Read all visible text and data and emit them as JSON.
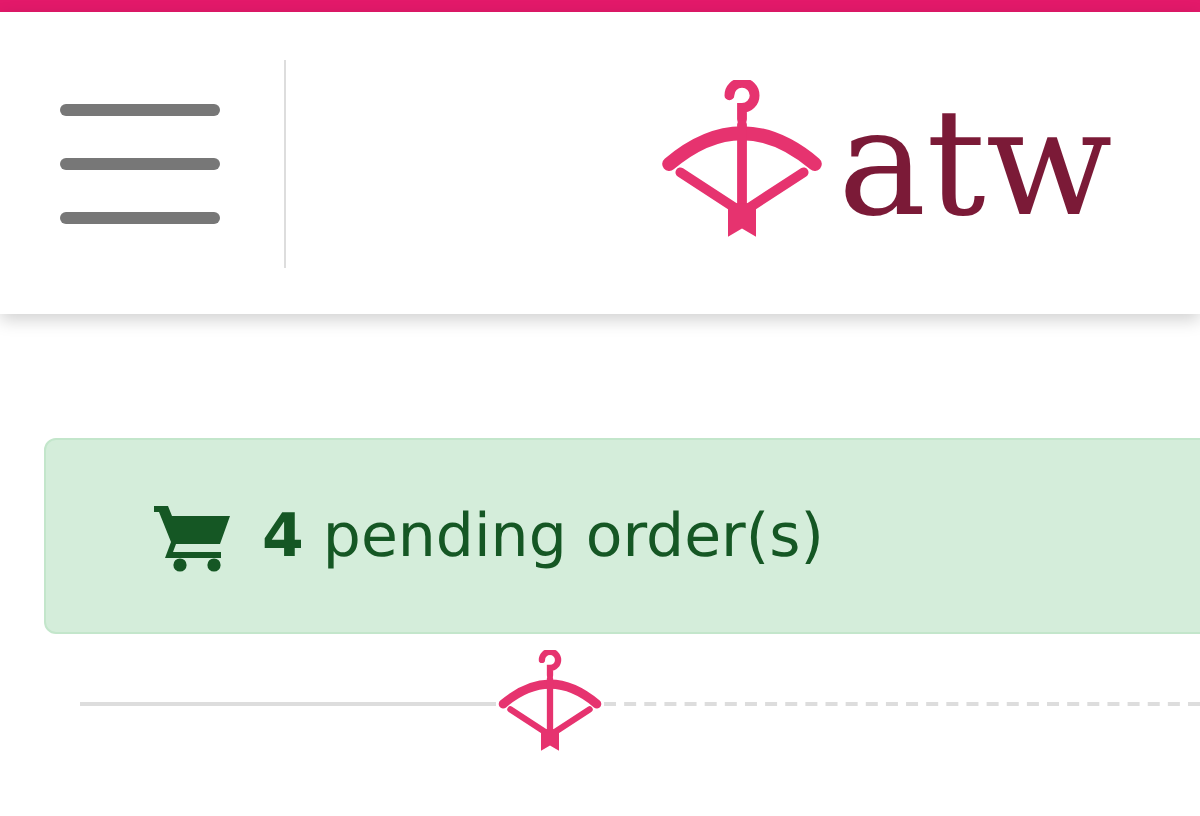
{
  "header": {
    "logo_text": "atw"
  },
  "alert": {
    "message": "**4** pending order(s)"
  }
}
